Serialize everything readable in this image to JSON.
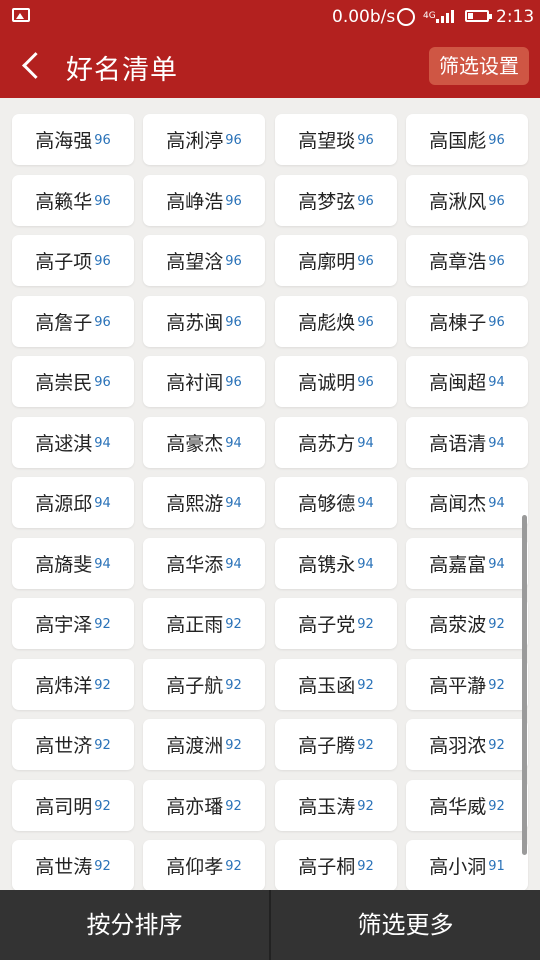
{
  "status": {
    "speed": "0.00b/s",
    "network": "4G",
    "time": "2:13"
  },
  "header": {
    "title": "好名清单",
    "filter_settings": "筛选设置"
  },
  "names": [
    {
      "name": "高海强",
      "score": "96"
    },
    {
      "name": "高浰渟",
      "score": "96"
    },
    {
      "name": "高望琰",
      "score": "96"
    },
    {
      "name": "高国彪",
      "score": "96"
    },
    {
      "name": "高籁华",
      "score": "96"
    },
    {
      "name": "高峥浩",
      "score": "96"
    },
    {
      "name": "高梦弦",
      "score": "96"
    },
    {
      "name": "高湫风",
      "score": "96"
    },
    {
      "name": "高子项",
      "score": "96"
    },
    {
      "name": "高望浛",
      "score": "96"
    },
    {
      "name": "高廓明",
      "score": "96"
    },
    {
      "name": "高章浩",
      "score": "96"
    },
    {
      "name": "高詹子",
      "score": "96"
    },
    {
      "name": "高苏闽",
      "score": "96"
    },
    {
      "name": "高彪焕",
      "score": "96"
    },
    {
      "name": "高棟子",
      "score": "96"
    },
    {
      "name": "高崇民",
      "score": "96"
    },
    {
      "name": "高衬闻",
      "score": "96"
    },
    {
      "name": "高诚明",
      "score": "96"
    },
    {
      "name": "高闽超",
      "score": "94"
    },
    {
      "name": "高逑淇",
      "score": "94"
    },
    {
      "name": "高豪杰",
      "score": "94"
    },
    {
      "name": "高苏方",
      "score": "94"
    },
    {
      "name": "高语清",
      "score": "94"
    },
    {
      "name": "高源邱",
      "score": "94"
    },
    {
      "name": "高熙游",
      "score": "94"
    },
    {
      "name": "高够德",
      "score": "94"
    },
    {
      "name": "高闻杰",
      "score": "94"
    },
    {
      "name": "高旖斐",
      "score": "94"
    },
    {
      "name": "高华添",
      "score": "94"
    },
    {
      "name": "高镌永",
      "score": "94"
    },
    {
      "name": "高嘉富",
      "score": "94"
    },
    {
      "name": "高宇泽",
      "score": "92"
    },
    {
      "name": "高正雨",
      "score": "92"
    },
    {
      "name": "高子党",
      "score": "92"
    },
    {
      "name": "高荥波",
      "score": "92"
    },
    {
      "name": "高炜洋",
      "score": "92"
    },
    {
      "name": "高子航",
      "score": "92"
    },
    {
      "name": "高玉函",
      "score": "92"
    },
    {
      "name": "高平瀞",
      "score": "92"
    },
    {
      "name": "高世济",
      "score": "92"
    },
    {
      "name": "高渡洲",
      "score": "92"
    },
    {
      "name": "高子腾",
      "score": "92"
    },
    {
      "name": "高羽浓",
      "score": "92"
    },
    {
      "name": "高司明",
      "score": "92"
    },
    {
      "name": "高亦璠",
      "score": "92"
    },
    {
      "name": "高玉涛",
      "score": "92"
    },
    {
      "name": "高华威",
      "score": "92"
    },
    {
      "name": "高世涛",
      "score": "92"
    },
    {
      "name": "高仰孝",
      "score": "92"
    },
    {
      "name": "高子桐",
      "score": "92"
    },
    {
      "name": "高小洞",
      "score": "91"
    }
  ],
  "bottom": {
    "sort": "按分排序",
    "more": "筛选更多"
  }
}
